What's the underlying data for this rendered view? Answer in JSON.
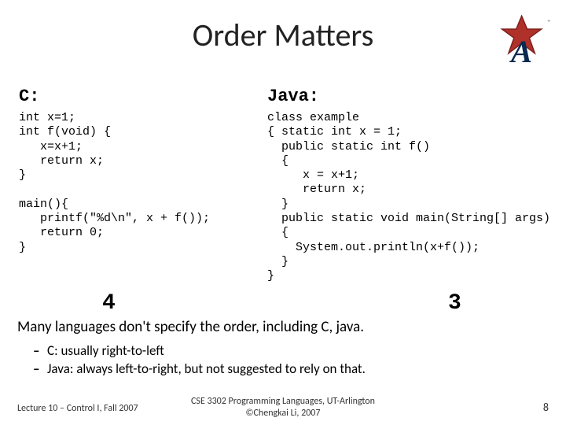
{
  "title": "Order Matters",
  "c": {
    "heading": "C:",
    "code": "int x=1;\nint f(void) {\n   x=x+1;\n   return x;\n}\n\nmain(){\n   printf(\"%d\\n\", x + f());\n   return 0;\n}",
    "result": "4"
  },
  "java": {
    "heading": "Java:",
    "code": "class example\n{ static int x = 1;\n  public static int f()\n  {\n     x = x+1;\n     return x;\n  }\n  public static void main(String[] args)\n  {\n    System.out.println(x+f());\n  }\n}",
    "result": "3"
  },
  "body": {
    "line": "Many languages don't specify the order, including C, java.",
    "bullets": [
      "C: usually right-to-left",
      "Java: always left-to-right, but not suggested to rely on that."
    ]
  },
  "footer": {
    "left": "Lecture 10 – Control I, Fall 2007",
    "center1": "CSE 3302 Programming Languages, UT-Arlington",
    "center2": "©Chengkai Li, 2007",
    "right": "8"
  },
  "logo": {
    "letter": "A",
    "star_fill": "#b0302a",
    "a_fill": "#0b2a52"
  }
}
